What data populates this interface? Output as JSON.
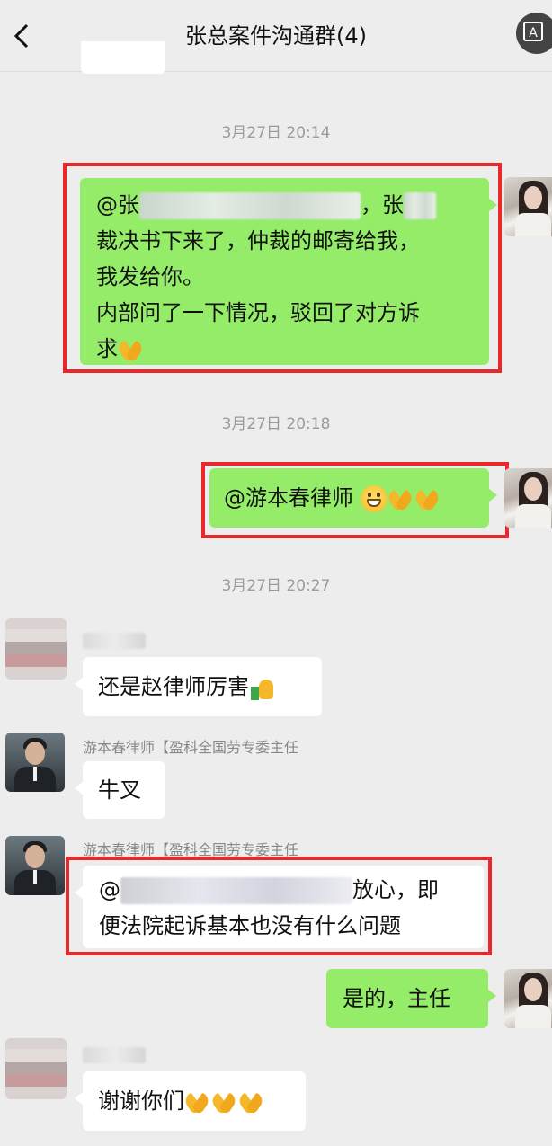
{
  "header": {
    "title": "张总案件沟通群(4)",
    "back_icon": "chevron-left-icon",
    "more_icon": "more-icon",
    "more_glyph": "A",
    "dots": "··"
  },
  "messages": [
    {
      "type": "time",
      "text": "3月27日 20:14"
    },
    {
      "type": "bubble",
      "side": "right",
      "highlighted": true,
      "line1_start": "@张",
      "line1_end": "，张",
      "line2": "裁决书下来了，仲裁的邮寄给我，",
      "line3": "我发给你。",
      "line4": "内部问了一下情况，驳回了对方诉",
      "line5": "求",
      "emoji": "pray-icon"
    },
    {
      "type": "time",
      "text": "3月27日 20:18"
    },
    {
      "type": "bubble",
      "side": "right",
      "highlighted": true,
      "text": "@游本春律师 ",
      "emojis": [
        "grin-icon",
        "pray-icon",
        "pray-icon"
      ]
    },
    {
      "type": "time",
      "text": "3月27日 20:27"
    },
    {
      "type": "bubble",
      "side": "left",
      "text": "还是赵律师厉害",
      "emoji": "thumbs-up-icon"
    },
    {
      "type": "bubble",
      "side": "left",
      "sender": "游本春律师【盈科全国劳专委主任",
      "text": "牛叉"
    },
    {
      "type": "bubble",
      "side": "left",
      "highlighted": true,
      "sender": "游本春律师【盈科全国劳专委主任",
      "line1_start": "@",
      "line1_end": "放心，即",
      "line2": "便法院起诉基本也没有什么问题"
    },
    {
      "type": "bubble",
      "side": "right",
      "text": "是的，主任"
    },
    {
      "type": "bubble",
      "side": "left",
      "text": "谢谢你们",
      "emojis": [
        "pray-icon",
        "pray-icon",
        "pray-icon"
      ]
    }
  ],
  "colors": {
    "my_bubble": "#95ec69",
    "other_bubble": "#ffffff",
    "highlight": "#e8282a",
    "background": "#ededed"
  }
}
